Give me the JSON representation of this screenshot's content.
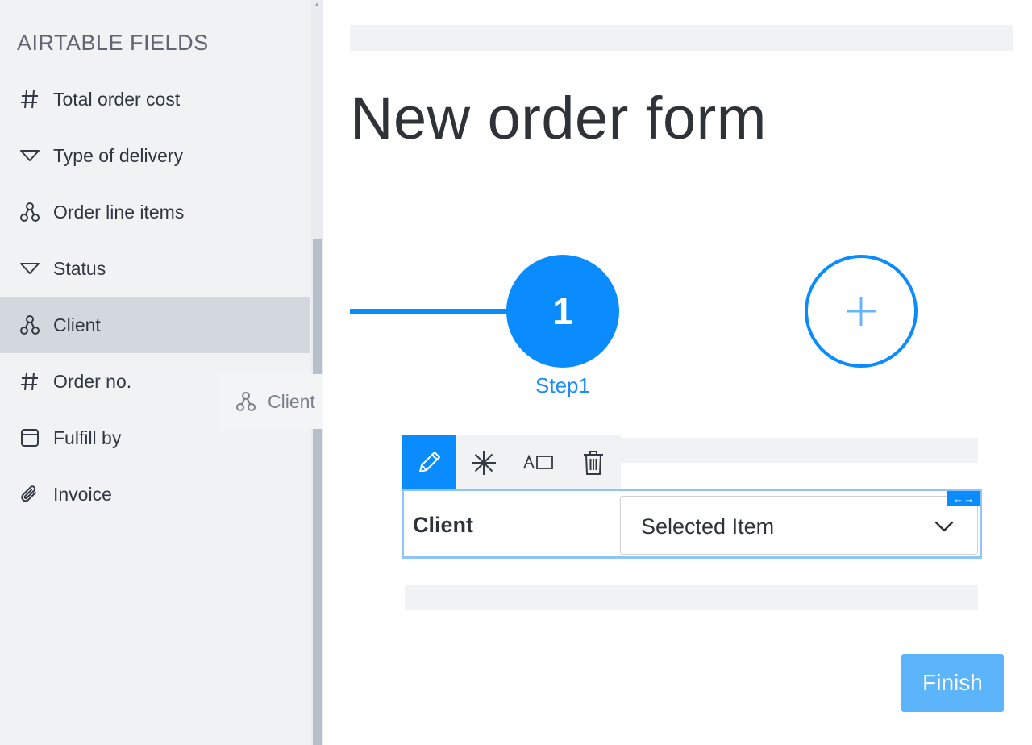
{
  "sidebar": {
    "title": "AIRTABLE FIELDS",
    "fields": [
      {
        "label": "Total order cost",
        "icon": "hash-icon"
      },
      {
        "label": "Type of delivery",
        "icon": "single-select-icon"
      },
      {
        "label": "Order line items",
        "icon": "linked-record-icon"
      },
      {
        "label": "Status",
        "icon": "single-select-icon"
      },
      {
        "label": "Client",
        "icon": "linked-record-icon",
        "active": true
      },
      {
        "label": "Order no.",
        "icon": "hash-icon"
      },
      {
        "label": "Fulfill by",
        "icon": "date-icon"
      },
      {
        "label": "Invoice",
        "icon": "attachment-icon"
      }
    ]
  },
  "drag_ghost": {
    "label": "Client",
    "icon": "linked-record-icon"
  },
  "form": {
    "title": "New order form",
    "step": {
      "number": "1",
      "label": "Step1"
    },
    "toolbar": [
      "edit-icon",
      "required-icon",
      "label-layout-icon",
      "trash-icon"
    ],
    "field": {
      "label": "Client",
      "value": "Selected Item"
    },
    "resize_handle": "←→",
    "finish_label": "Finish"
  },
  "colors": {
    "accent": "#0a8cff",
    "finish": "#5cb4fb",
    "sidebar_bg": "#f1f2f4",
    "active_row": "#d3d8df"
  }
}
